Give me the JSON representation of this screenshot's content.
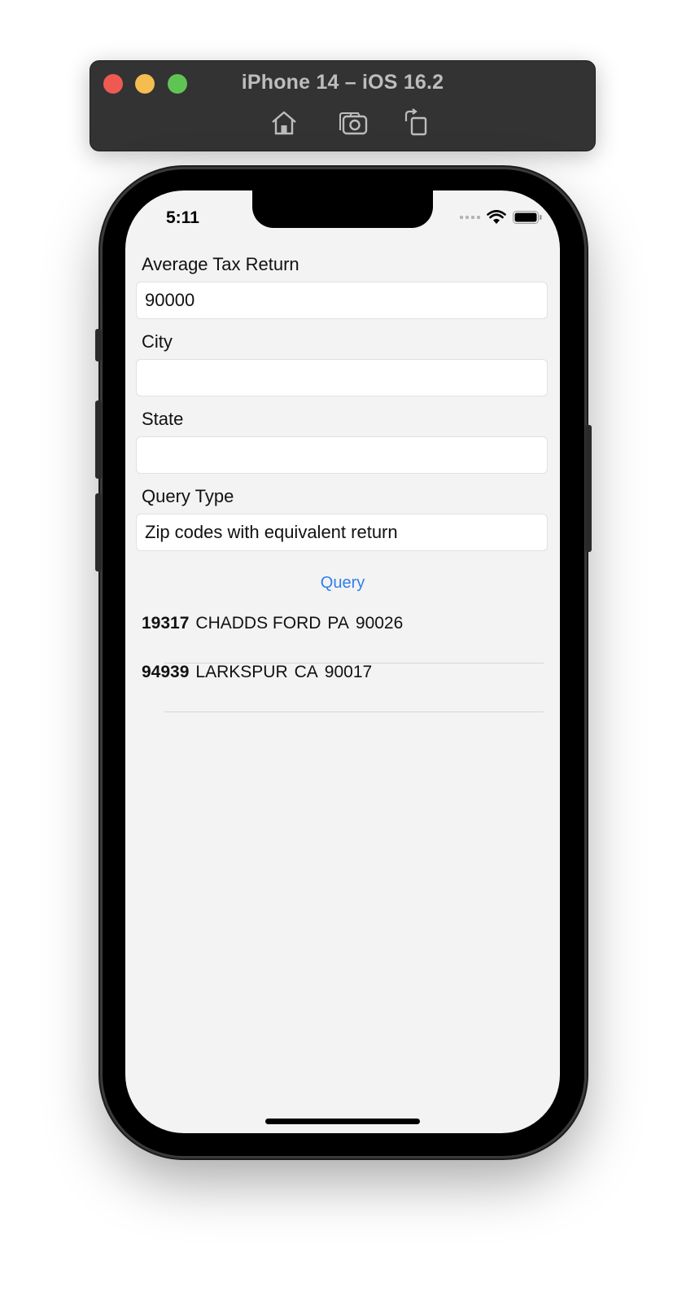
{
  "simulator": {
    "title": "iPhone 14 – iOS 16.2",
    "toolbar_icons": [
      "home-icon",
      "screenshot-icon",
      "rotate-icon"
    ]
  },
  "status_bar": {
    "time": "5:11",
    "icons": [
      "cellular-signal-icon",
      "wifi-icon",
      "battery-icon"
    ]
  },
  "form": {
    "avg_tax_label": "Average Tax Return",
    "avg_tax_value": "90000",
    "city_label": "City",
    "city_value": "",
    "state_label": "State",
    "state_value": "",
    "query_type_label": "Query Type",
    "query_type_value": "Zip codes with equivalent return",
    "query_button": "Query"
  },
  "results": [
    {
      "zip": "19317",
      "city": "CHADDS FORD",
      "state": "PA",
      "value": "90026"
    },
    {
      "zip": "94939",
      "city": "LARKSPUR",
      "state": "CA",
      "value": "90017"
    }
  ],
  "colors": {
    "accent": "#2f80ed",
    "screen_background": "#f3f3f3",
    "toolbar": "#333333"
  }
}
